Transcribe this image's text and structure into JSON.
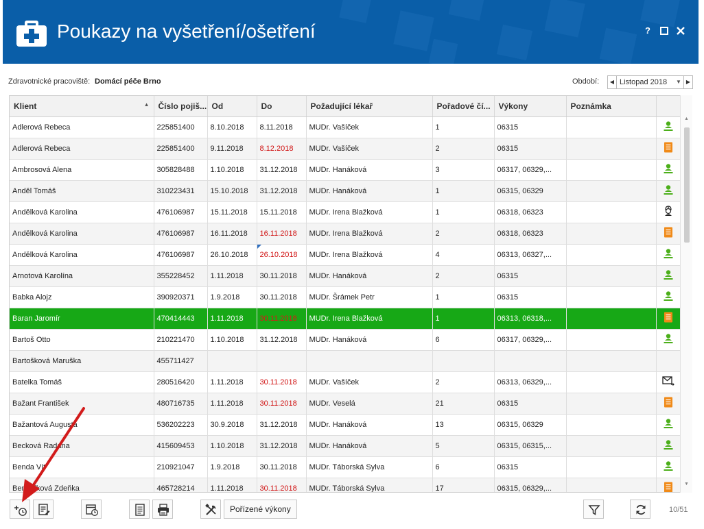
{
  "window": {
    "title": "Poukazy na vyšetření/ošetření",
    "help_label": "?"
  },
  "filter": {
    "workplace_label": "Zdravotnické pracoviště:",
    "workplace_value": "Domácí péče Brno",
    "period_label": "Období:",
    "period_value": "Listopad 2018"
  },
  "table": {
    "columns": [
      "Klient",
      "Číslo pojiš...",
      "Od",
      "Do",
      "Požadující lékař",
      "Pořadové čí...",
      "Výkony",
      "Poznámka",
      ""
    ],
    "rows": [
      {
        "client": "Adlerová Rebeca",
        "insurance": "225851400",
        "from": "8.10.2018",
        "to": "8.11.2018",
        "to_red": false,
        "doctor": "MUDr. Vašíček",
        "order": "1",
        "services": "06315",
        "note": "",
        "icon": "person-icon"
      },
      {
        "client": "Adlerová Rebeca",
        "insurance": "225851400",
        "from": "9.11.2018",
        "to": "8.12.2018",
        "to_red": true,
        "doctor": "MUDr. Vašíček",
        "order": "2",
        "services": "06315",
        "note": "",
        "icon": "document-icon"
      },
      {
        "client": "Ambrosová Alena",
        "insurance": "305828488",
        "from": "1.10.2018",
        "to": "31.12.2018",
        "to_red": false,
        "doctor": "MUDr. Hanáková",
        "order": "3",
        "services": "06317, 06329,...",
        "note": "",
        "icon": "person-icon"
      },
      {
        "client": "Anděl Tomáš",
        "insurance": "310223431",
        "from": "15.10.2018",
        "to": "31.12.2018",
        "to_red": false,
        "doctor": "MUDr. Hanáková",
        "order": "1",
        "services": "06315, 06329",
        "note": "",
        "icon": "person-icon"
      },
      {
        "client": "Andělková Karolina",
        "insurance": "476106987",
        "from": "15.11.2018",
        "to": "15.11.2018",
        "to_red": false,
        "doctor": "MUDr. Irena Blažková",
        "order": "1",
        "services": "06318, 06323",
        "note": "",
        "icon": "nurse-icon"
      },
      {
        "client": "Andělková Karolina",
        "insurance": "476106987",
        "from": "16.11.2018",
        "to": "16.11.2018",
        "to_red": true,
        "doctor": "MUDr. Irena Blažková",
        "order": "2",
        "services": "06318, 06323",
        "note": "",
        "icon": "document-icon"
      },
      {
        "client": "Andělková Karolina",
        "insurance": "476106987",
        "from": "26.10.2018",
        "to": "26.10.2018",
        "to_red": true,
        "doctor": "MUDr. Irena Blažková",
        "order": "4",
        "services": "06313, 06327,...",
        "note": "",
        "icon": "person-icon"
      },
      {
        "client": "Arnotová Karolína",
        "insurance": "355228452",
        "from": "1.11.2018",
        "to": "30.11.2018",
        "to_red": false,
        "doctor": "MUDr. Hanáková",
        "order": "2",
        "services": "06315",
        "note": "",
        "icon": "person-icon"
      },
      {
        "client": "Babka Alojz",
        "insurance": "390920371",
        "from": "1.9.2018",
        "to": "30.11.2018",
        "to_red": false,
        "doctor": "MUDr. Šrámek Petr",
        "order": "1",
        "services": "06315",
        "note": "",
        "icon": "person-icon"
      },
      {
        "client": "Baran Jaromír",
        "insurance": "470414443",
        "from": "1.11.2018",
        "to": "30.11.2018",
        "to_red": true,
        "doctor": "MUDr. Irena Blažková",
        "order": "1",
        "services": "06313, 06318,...",
        "note": "",
        "icon": "document-icon"
      },
      {
        "client": "Bartoš Otto",
        "insurance": "210221470",
        "from": "1.10.2018",
        "to": "31.12.2018",
        "to_red": false,
        "doctor": "MUDr. Hanáková",
        "order": "6",
        "services": "06317, 06329,...",
        "note": "",
        "icon": "person-icon"
      },
      {
        "client": "Bartošková Maruška",
        "insurance": "455711427",
        "from": "",
        "to": "",
        "to_red": false,
        "doctor": "",
        "order": "",
        "services": "",
        "note": "",
        "icon": ""
      },
      {
        "client": "Batelka Tomáš",
        "insurance": "280516420",
        "from": "1.11.2018",
        "to": "30.11.2018",
        "to_red": true,
        "doctor": "MUDr. Vašíček",
        "order": "2",
        "services": "06313, 06329,...",
        "note": "",
        "icon": "mail-icon"
      },
      {
        "client": "Bažant František",
        "insurance": "480716735",
        "from": "1.11.2018",
        "to": "30.11.2018",
        "to_red": true,
        "doctor": "MUDr. Veselá",
        "order": "21",
        "services": "06315",
        "note": "",
        "icon": "document-icon"
      },
      {
        "client": "Bažantová Augusta",
        "insurance": "536202223",
        "from": "30.9.2018",
        "to": "31.12.2018",
        "to_red": false,
        "doctor": "MUDr. Hanáková",
        "order": "13",
        "services": "06315, 06329",
        "note": "",
        "icon": "person-icon"
      },
      {
        "client": "Becková Radana",
        "insurance": "415609453",
        "from": "1.10.2018",
        "to": "31.12.2018",
        "to_red": false,
        "doctor": "MUDr. Hanáková",
        "order": "5",
        "services": "06315, 06315,...",
        "note": "",
        "icon": "person-icon"
      },
      {
        "client": "Benda Vít",
        "insurance": "210921047",
        "from": "1.9.2018",
        "to": "30.11.2018",
        "to_red": false,
        "doctor": "MUDr. Táborská Sylva",
        "order": "6",
        "services": "06315",
        "note": "",
        "icon": "person-icon"
      },
      {
        "client": "Benedíková Zdeňka",
        "insurance": "465728214",
        "from": "1.11.2018",
        "to": "30.11.2018",
        "to_red": true,
        "doctor": "MUDr. Táborská Sylva",
        "order": "17",
        "services": "06315, 06329,...",
        "note": "",
        "icon": "document-icon"
      }
    ],
    "selected_row": 9
  },
  "toolbar": {
    "performed_label": "Pořízené výkony",
    "counter": "10/51"
  },
  "colors": {
    "titlebar": "#0a5ea8",
    "selected_row": "#17a816",
    "red_date": "#d01010",
    "annotation_arrow": "#d21b1b"
  }
}
